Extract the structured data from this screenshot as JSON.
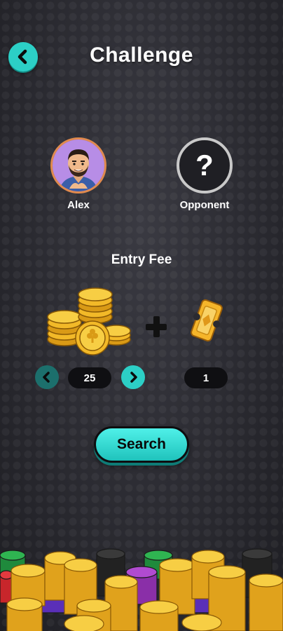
{
  "header": {
    "title": "Challenge",
    "back_icon": "chevron-left-icon"
  },
  "players": {
    "me": {
      "name": "Alex",
      "avatar_icon": "user-avatar"
    },
    "opponent": {
      "name": "Opponent",
      "avatar_icon": "question-mark-icon",
      "placeholder_symbol": "?"
    }
  },
  "entry_fee": {
    "label": "Entry Fee",
    "coins": "25",
    "tickets": "1",
    "coin_icon": "coin-pile-icon",
    "ticket_icon": "ticket-icon",
    "plus_icon": "plus-icon"
  },
  "actions": {
    "search_label": "Search"
  },
  "colors": {
    "accent": "#2ccfc6",
    "accent_dark": "#1c6f6c",
    "gold": "#f5c32c",
    "background": "#2a2a30",
    "pill": "#0f0f12"
  }
}
